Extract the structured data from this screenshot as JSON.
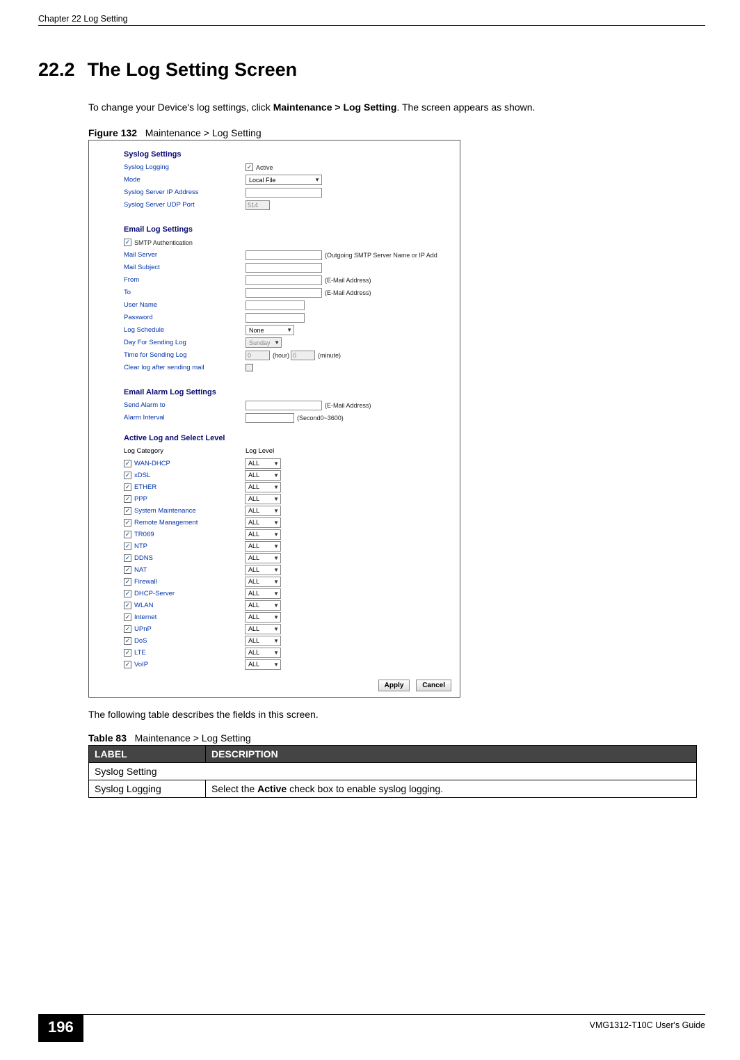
{
  "header": {
    "left": "Chapter 22 Log Setting",
    "right": ""
  },
  "section": {
    "number": "22.2",
    "title": "The Log Setting Screen"
  },
  "intro": {
    "pre": "To change your Device's log settings, click ",
    "bold": "Maintenance > Log Setting",
    "post": ". The screen appears as shown."
  },
  "figure": {
    "label_pre": "Figure 132",
    "label_post": "Maintenance > Log Setting"
  },
  "ss": {
    "syslog": {
      "heading": "Syslog Settings",
      "rows": [
        {
          "label": "Syslog Logging",
          "type": "checkbox",
          "checked": true,
          "after": "Active"
        },
        {
          "label": "Mode",
          "type": "select",
          "value": "Local File",
          "w": "w110"
        },
        {
          "label": "Syslog Server IP Address",
          "type": "input",
          "w": "w110"
        },
        {
          "label": "Syslog Server UDP Port",
          "type": "input-dis",
          "value": "514",
          "w": "w35"
        }
      ]
    },
    "email": {
      "heading": "Email Log Settings",
      "smtp": {
        "label": "SMTP Authentication"
      },
      "rows": [
        {
          "label": "Mail Server",
          "type": "input",
          "w": "w110",
          "after": "(Outgoing SMTP Server Name or IP Add"
        },
        {
          "label": "Mail Subject",
          "type": "input",
          "w": "w110"
        },
        {
          "label": "From",
          "type": "input",
          "w": "w110",
          "after": "(E-Mail Address)"
        },
        {
          "label": "To",
          "type": "input",
          "w": "w110",
          "after": "(E-Mail Address)"
        },
        {
          "label": "User Name",
          "type": "input",
          "w": "w85"
        },
        {
          "label": "Password",
          "type": "input",
          "w": "w85"
        },
        {
          "label": "Log Schedule",
          "type": "select",
          "value": "None",
          "w": "w70"
        },
        {
          "label": "Day For Sending Log",
          "type": "select-dis",
          "value": "Sunday",
          "w": "w52"
        },
        {
          "label": "Time for Sending Log",
          "type": "time",
          "hour": "0",
          "min": "0",
          "hour_lbl": "(hour)",
          "min_lbl": "(minute)"
        },
        {
          "label": "Clear log after sending mail",
          "type": "checkbox-empty"
        }
      ]
    },
    "alarm": {
      "heading": "Email Alarm Log Settings",
      "rows": [
        {
          "label": "Send Alarm to",
          "type": "input",
          "w": "w110",
          "after": "(E-Mail Address)"
        },
        {
          "label": "Alarm Interval",
          "type": "input",
          "w": "w70",
          "after": "(Second0~3600)"
        }
      ]
    },
    "active": {
      "heading": "Active Log and Select Level",
      "col1": "Log Category",
      "col2": "Log Level",
      "level_default": "ALL",
      "items": [
        "WAN-DHCP",
        "xDSL",
        "ETHER",
        "PPP",
        "System Maintenance",
        "Remote Management",
        "TR069",
        "NTP",
        "DDNS",
        "NAT",
        "Firewall",
        "DHCP-Server",
        "WLAN",
        "Internet",
        "UPnP",
        "DoS",
        "LTE",
        "VoIP"
      ]
    },
    "buttons": {
      "apply": "Apply",
      "cancel": "Cancel"
    }
  },
  "table_intro": "The following table describes the fields in this screen.",
  "table_label": {
    "pre": "Table 83",
    "post": "Maintenance > Log Setting"
  },
  "table": {
    "head": [
      "LABEL",
      "DESCRIPTION"
    ],
    "rows": [
      {
        "span": "Syslog Setting"
      },
      {
        "c1": "Syslog Logging",
        "c2_pre": "Select the ",
        "c2_bold": "Active",
        "c2_post": " check box to enable syslog logging."
      }
    ]
  },
  "footer": {
    "page": "196",
    "right": "VMG1312-T10C User's Guide"
  }
}
